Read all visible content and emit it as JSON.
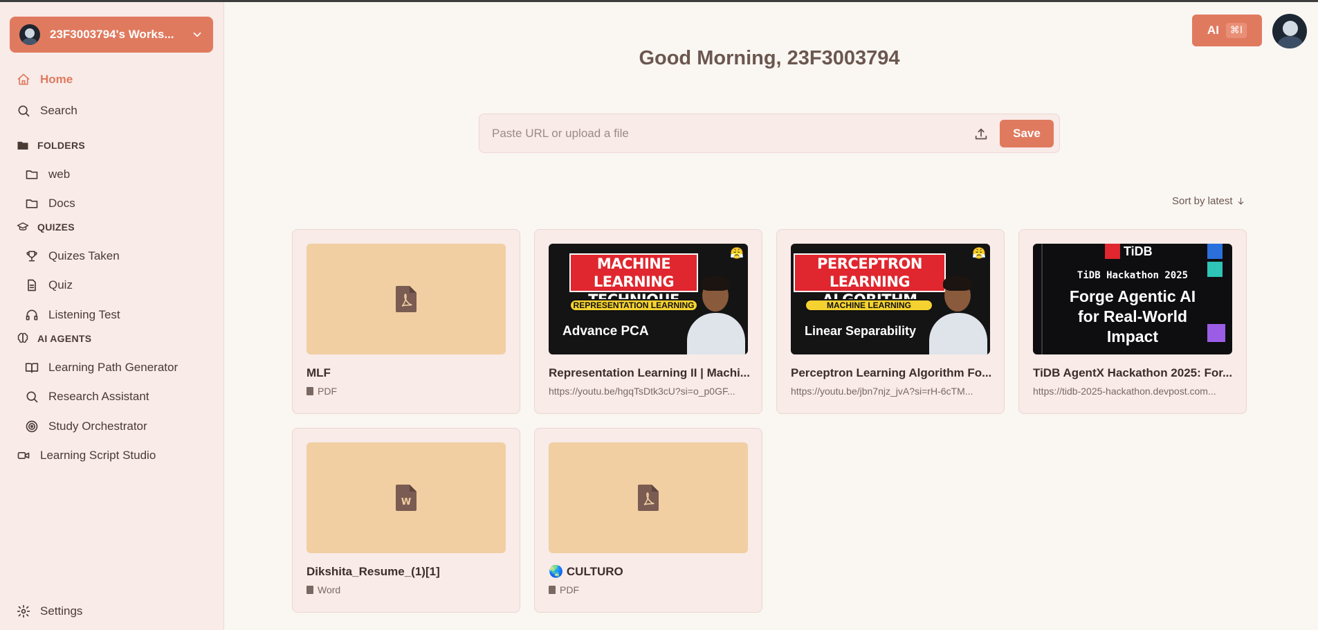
{
  "sidebar": {
    "workspace_name": "23F3003794's Works...",
    "nav": {
      "home": "Home",
      "search": "Search"
    },
    "sections": {
      "folders": "FOLDERS",
      "quizes": "QUIZES",
      "ai_agents": "AI AGENTS"
    },
    "folders": [
      "web",
      "Docs"
    ],
    "quizes": [
      "Quizes Taken",
      "Quiz",
      "Listening Test"
    ],
    "ai_agents": [
      "Learning Path Generator",
      "Research Assistant",
      "Study Orchestrator"
    ],
    "learning_script_studio": "Learning Script Studio",
    "settings": "Settings"
  },
  "header": {
    "ai_label": "AI",
    "ai_shortcut": "⌘I",
    "greeting": "Good Morning, 23F3003794"
  },
  "url_bar": {
    "placeholder": "Paste URL or upload a file",
    "save_label": "Save"
  },
  "sort_label": "Sort by latest",
  "cards": [
    {
      "title": "MLF",
      "subtitle": "PDF",
      "kind": "file-pdf"
    },
    {
      "title": "Representation Learning II | Machi...",
      "subtitle": "https://youtu.be/hgqTsDtk3cU?si=o_p0GF...",
      "kind": "video",
      "thumb": {
        "band": [
          "MACHINE LEARNING",
          "TECHNIQUE"
        ],
        "strip": "REPRESENTATION LEARNING",
        "caption": "Advance PCA"
      }
    },
    {
      "title": "Perceptron Learning Algorithm Fo...",
      "subtitle": "https://youtu.be/jbn7njz_jvA?si=rH-6cTM...",
      "kind": "video",
      "thumb": {
        "band": [
          "PERCEPTRON",
          "LEARNING ALGORITHM"
        ],
        "strip": "MACHINE LEARNING",
        "caption": "Linear Separability"
      }
    },
    {
      "title": "TiDB AgentX Hackathon 2025: For...",
      "subtitle": "https://tidb-2025-hackathon.devpost.com...",
      "kind": "banner",
      "thumb": {
        "logo": "TiDB",
        "line1": "TiDB Hackathon 2025",
        "line2": [
          "Forge Agentic AI",
          "for Real-World",
          "Impact"
        ]
      }
    },
    {
      "title": "Dikshita_Resume_(1)[1]",
      "subtitle": "Word",
      "kind": "file-word"
    },
    {
      "title": "🌏 CULTURO",
      "subtitle": "PDF",
      "kind": "file-pdf"
    }
  ],
  "colors": {
    "accent": "#e07a5f",
    "sidebar_bg": "#f8ebe8",
    "page_bg": "#faf6f2",
    "thumb_placeholder": "#f1cfa2"
  }
}
